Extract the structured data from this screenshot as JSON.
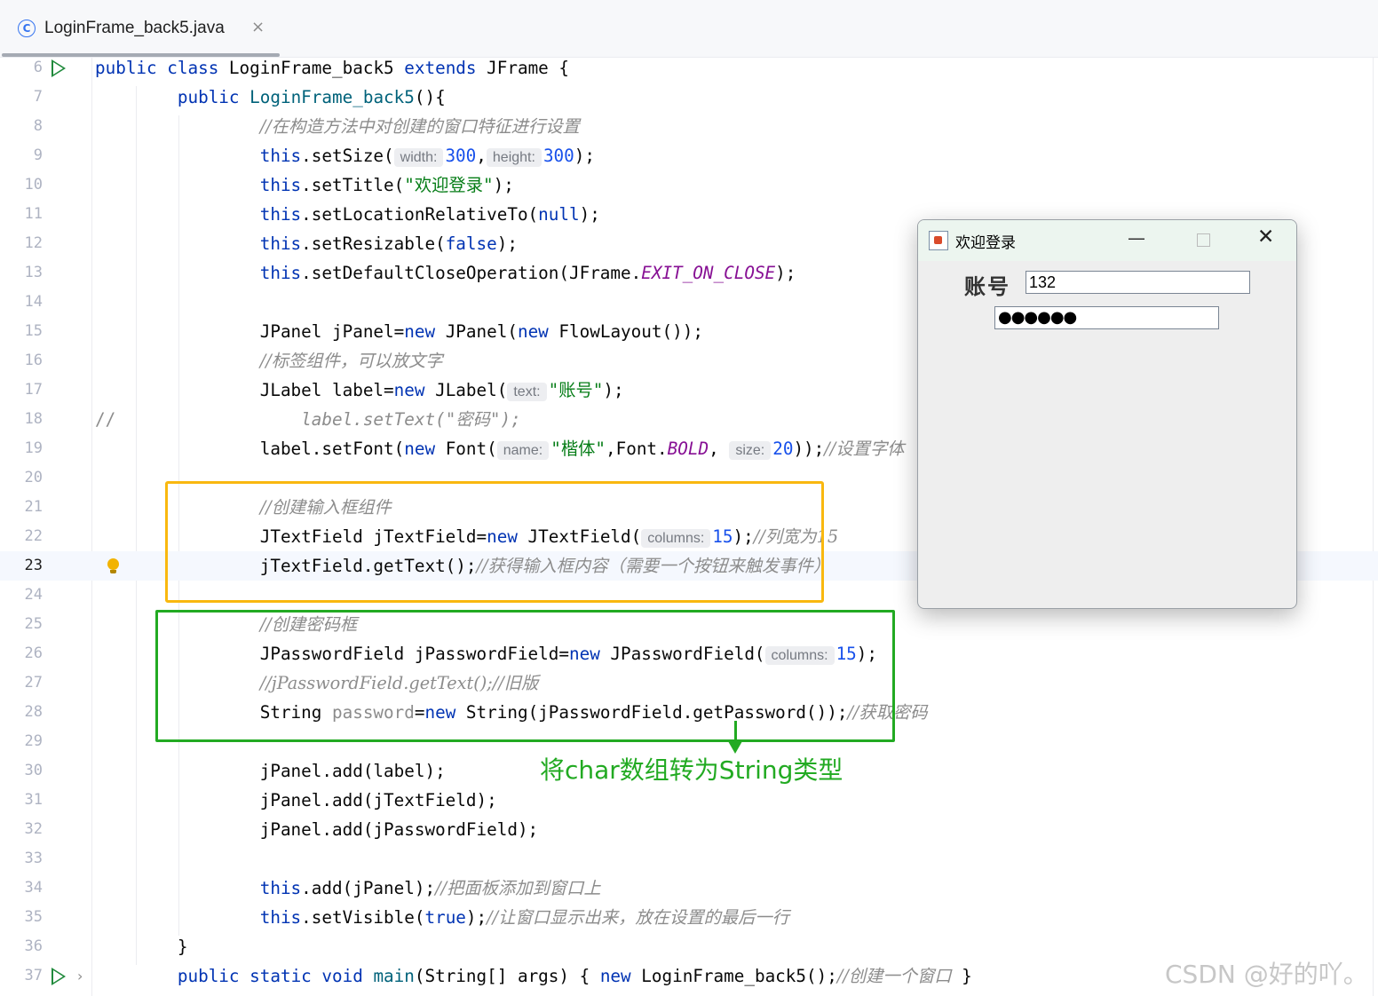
{
  "tab": {
    "icon": "class-icon",
    "icon_glyph": "C",
    "filename": "LoginFrame_back5.java",
    "close_glyph": "×"
  },
  "editor": {
    "current_line": 23,
    "line_numbers": [
      "6",
      "7",
      "8",
      "9",
      "10",
      "11",
      "12",
      "13",
      "14",
      "15",
      "16",
      "17",
      "18",
      "19",
      "20",
      "21",
      "22",
      "23",
      "24",
      "25",
      "26",
      "27",
      "28",
      "29",
      "30",
      "31",
      "32",
      "33",
      "34",
      "35",
      "36",
      "37"
    ],
    "code": {
      "l6": {
        "kw1": "public class ",
        "name": "LoginFrame_back5 ",
        "kw2": "extends ",
        "rest": "JFrame {"
      },
      "l7": {
        "kw": "public ",
        "fn": "LoginFrame_back5",
        "rest": "(){"
      },
      "l8": {
        "cmt": "//在构造方法中对创建的窗口特征进行设置"
      },
      "l9": {
        "this": "this",
        "call": ".setSize(",
        "hint1": "width:",
        "num1": "300",
        "sep": ",",
        "hint2": "height:",
        "num2": "300",
        "end": ");"
      },
      "l10": {
        "this": "this",
        "call": ".setTitle(",
        "str": "\"欢迎登录\"",
        "end": ");"
      },
      "l11": {
        "this": "this",
        "call": ".setLocationRelativeTo(",
        "kw": "null",
        "end": ");"
      },
      "l12": {
        "this": "this",
        "call": ".setResizable(",
        "kw": "false",
        "end": ");"
      },
      "l13": {
        "this": "this",
        "call": ".setDefaultCloseOperation(JFrame.",
        "const": "EXIT_ON_CLOSE",
        "end": ");"
      },
      "l15": {
        "a": "JPanel jPanel=",
        "kw1": "new",
        "b": " JPanel(",
        "kw2": "new",
        "c": " FlowLayout());"
      },
      "l16": {
        "cmt": "//标签组件，可以放文字"
      },
      "l17": {
        "a": "JLabel label=",
        "kw": "new",
        "b": " JLabel(",
        "hint": "text:",
        "str": "\"账号\"",
        "end": ");"
      },
      "l18": {
        "slashes": "//",
        "cmt": "label.setText(\"密码\");"
      },
      "l19": {
        "a": "label.setFont(",
        "kw": "new",
        "b": " Font(",
        "hint1": "name:",
        "str": "\"楷体\"",
        "c": ",Font.",
        "const": "BOLD",
        "d": ", ",
        "hint2": "size:",
        "num": "20",
        "e": "));",
        "cmt": "//设置字体"
      },
      "l21": {
        "cmt": "//创建输入框组件"
      },
      "l22": {
        "a": "JTextField jTextField=",
        "kw": "new",
        "b": " JTextField(",
        "hint": "columns:",
        "num": "15",
        "c": ");",
        "cmt": "//列宽为15"
      },
      "l23": {
        "a": "jTextField.getText();",
        "cmt": "//获得输入框内容（需要一个按钮来触发事件）"
      },
      "l25": {
        "cmt": "//创建密码框"
      },
      "l26": {
        "a": "JPasswordField jPasswordField=",
        "kw": "new",
        "b": " JPasswordField(",
        "hint": "columns:",
        "num": "15",
        "c": ");"
      },
      "l27": {
        "cmt": "//jPasswordField.getText();//旧版"
      },
      "l28": {
        "a": "String ",
        "var": "password",
        "b": "=",
        "kw": "new",
        "c": " String(jPasswordField.getPassword());",
        "cmt": "//获取密码"
      },
      "l30": {
        "a": "jPanel.add(label);"
      },
      "l31": {
        "a": "jPanel.add(jTextField);"
      },
      "l32": {
        "a": "jPanel.add(jPasswordField);"
      },
      "l34": {
        "this": "this",
        "a": ".add(jPanel);",
        "cmt": "//把面板添加到窗口上"
      },
      "l35": {
        "this": "this",
        "a": ".setVisible(",
        "kw": "true",
        "b": ");",
        "cmt": "//让窗口显示出来，放在设置的最后一行"
      },
      "l36": {
        "a": "}"
      },
      "l37": {
        "kw": "public static void ",
        "fn": "main",
        "a": "(String[] args) { ",
        "kw2": "new",
        "b": " LoginFrame_back5();",
        "cmt": "//创建一个窗口",
        "c": " }"
      }
    }
  },
  "annotation": {
    "text": "将char数组转为String类型",
    "color": "#22aa22"
  },
  "highlight_colors": {
    "yellow": "#f9b80f",
    "green": "#22aa22"
  },
  "java_window": {
    "title": "欢迎登录",
    "minimize": "—",
    "close": "✕",
    "label": "账号",
    "text_field_value": "132",
    "password_value": "●●●●●●"
  },
  "watermark": "CSDN @好的吖。"
}
